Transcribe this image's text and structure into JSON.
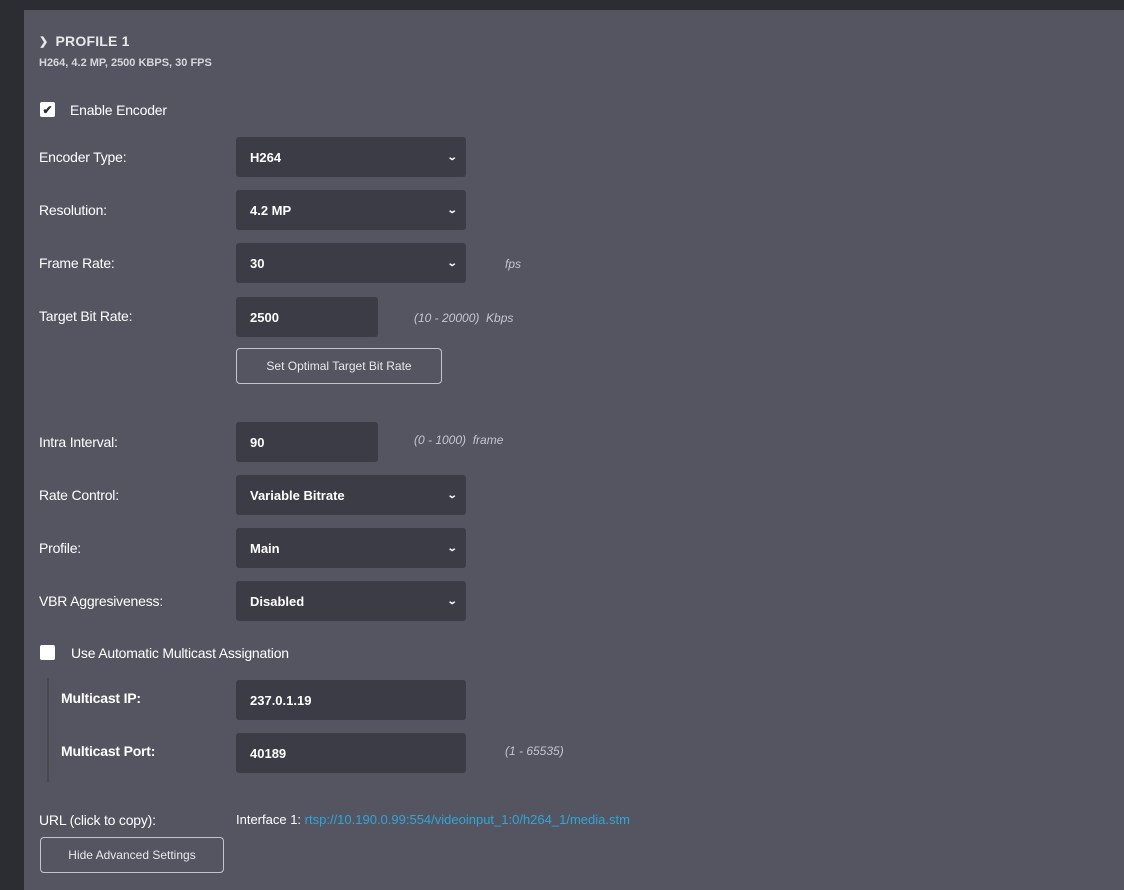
{
  "profile": {
    "title": "PROFILE 1",
    "summary": "H264, 4.2 MP, 2500 KBPS, 30 FPS"
  },
  "enable_encoder": {
    "label": "Enable Encoder",
    "checked": true,
    "check_glyph": "✔"
  },
  "encoder_type": {
    "label": "Encoder Type:",
    "value": "H264"
  },
  "resolution": {
    "label": "Resolution:",
    "value": "4.2 MP"
  },
  "frame_rate": {
    "label": "Frame Rate:",
    "value": "30",
    "unit": "fps"
  },
  "target_bit_rate": {
    "label": "Target Bit Rate:",
    "value": "2500",
    "range": "(10 - 20000)",
    "unit": "Kbps"
  },
  "optimal_button": {
    "label": "Set Optimal Target Bit Rate"
  },
  "intra_interval": {
    "label": "Intra Interval:",
    "value": "90",
    "range": "(0 - 1000)",
    "unit": "frame"
  },
  "rate_control": {
    "label": "Rate Control:",
    "value": "Variable Bitrate"
  },
  "profile_select": {
    "label": "Profile:",
    "value": "Main"
  },
  "vbr_aggressiveness": {
    "label": "VBR Aggresiveness:",
    "value": "Disabled"
  },
  "auto_multicast": {
    "label": "Use Automatic Multicast Assignation",
    "checked": false
  },
  "multicast_ip": {
    "label": "Multicast IP:",
    "value": "237.0.1.19"
  },
  "multicast_port": {
    "label": "Multicast Port:",
    "value": "40189",
    "range": "(1 - 65535)"
  },
  "url": {
    "label": "URL (click to copy):",
    "interface_label": "Interface 1:",
    "link": "rtsp://10.190.0.99:554/videoinput_1:0/h264_1/media.stm"
  },
  "advanced_button": {
    "label": "Hide Advanced Settings"
  },
  "icons": {
    "chevron": "chevron-down-icon",
    "check": "check-icon"
  },
  "colors": {
    "panel": "#545560",
    "field": "#3b3c45",
    "link": "#2fa6d9"
  }
}
